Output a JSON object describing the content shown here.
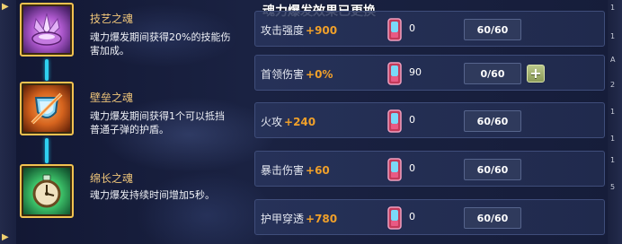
{
  "panel": {
    "title": "魂力爆发效果已更换"
  },
  "skills": [
    {
      "name": "技艺之魂",
      "desc": "魂力爆发期间获得20%的技能伤害加成。",
      "icon": "crystal-lotus-icon"
    },
    {
      "name": "壁垒之魂",
      "desc": "魂力爆发期间获得1个可以抵挡普通子弹的护盾。",
      "icon": "shield-slash-icon"
    },
    {
      "name": "绵长之魂",
      "desc": "魂力爆发持续时间增加5秒。",
      "icon": "clock-icon"
    }
  ],
  "stats": [
    {
      "label": "攻击强度",
      "bonus": "+900",
      "count": "0",
      "progress": "60/60",
      "fill": 1.0
    },
    {
      "label": "首领伤害",
      "bonus": "+0%",
      "count": "90",
      "progress": "0/60",
      "fill": 0.0,
      "has_add": true
    },
    {
      "label": "火攻",
      "bonus": "+240",
      "count": "0",
      "progress": "60/60",
      "fill": 1.0
    },
    {
      "label": "暴击伤害",
      "bonus": "+60",
      "count": "0",
      "progress": "60/60",
      "fill": 1.0
    },
    {
      "label": "护甲穿透",
      "bonus": "+780",
      "count": "0",
      "progress": "60/60",
      "fill": 1.0
    }
  ],
  "add_button": {
    "label": "+"
  },
  "colors": {
    "bonus": "#f0a02a",
    "skill_name": "#f0c67a",
    "icon_border": "#f2c250",
    "connector": "#2fd0f0",
    "add_button": "#a5b470"
  },
  "right_strip": [
    "1",
    "1",
    "A",
    "2",
    "1",
    "1",
    "1",
    "5"
  ]
}
